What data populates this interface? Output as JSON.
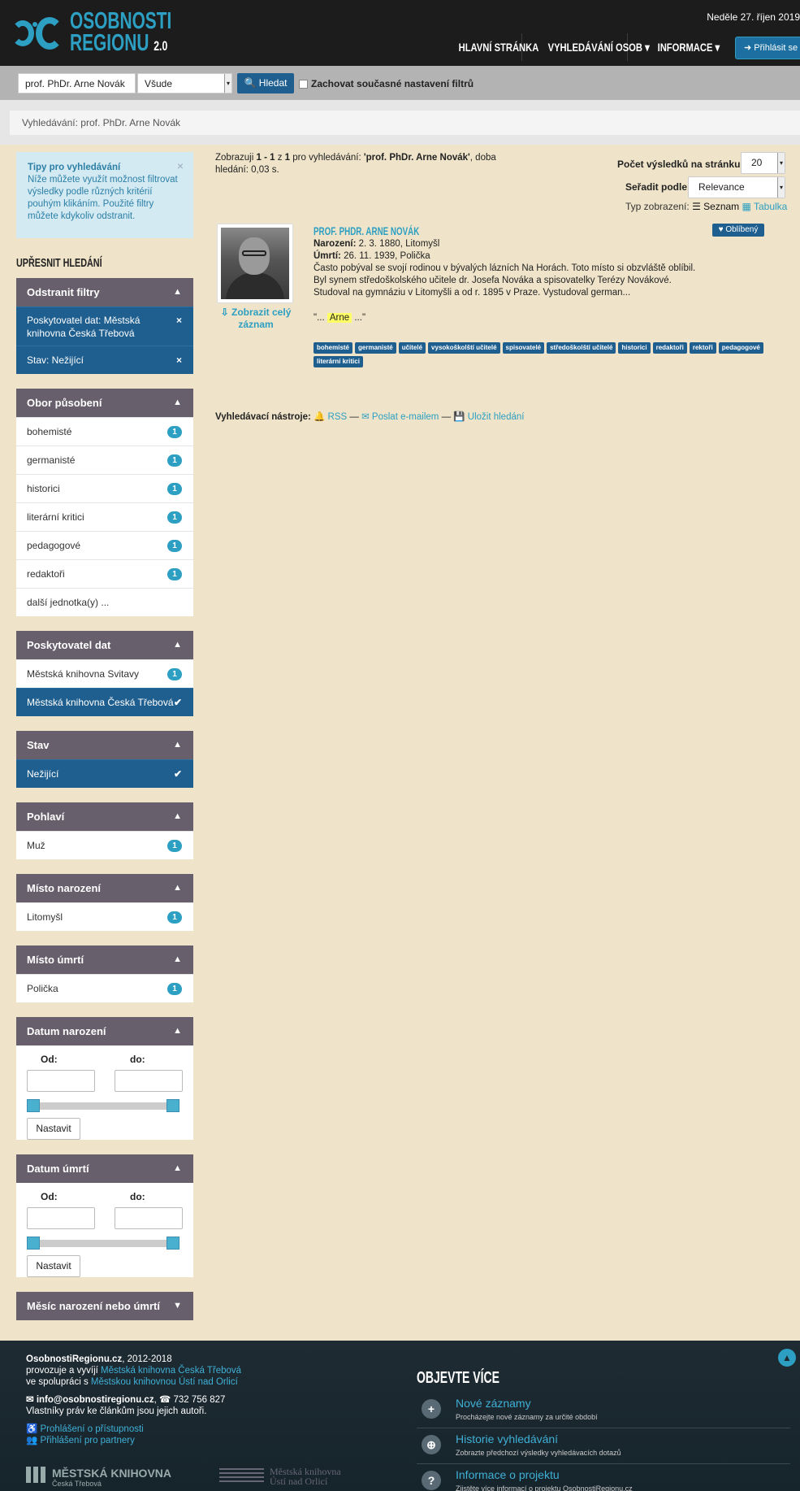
{
  "header": {
    "logo_line1": "OSOBNOSTI",
    "logo_line2": "REGIONU",
    "logo_version": "2.0",
    "date": "Neděle 27. říjen 2019",
    "nav": {
      "home": "HLAVNÍ STRÁNKA",
      "search": "VYHLEDÁVÁNÍ OSOB ▾",
      "info": "INFORMACE ▾"
    },
    "login": "➜ Přihlásit se"
  },
  "searchbar": {
    "query": "prof. PhDr. Arne Novák",
    "scope": "Všude",
    "search_button": "🔍 Hledat",
    "keep_filters": "Zachovat současné nastavení filtrů"
  },
  "breadcrumb": "Vyhledávání: prof. PhDr. Arne Novák",
  "sidebar": {
    "tips": {
      "title": "Tipy pro vyhledávání",
      "text": "Níže můžete využít možnost filtrovat výsledky podle různých kritérií pouhým klikáním. Použité filtry můžete kdykoliv odstranit.",
      "close": "×"
    },
    "refine_title": "UPŘESNIT HLEDÁNÍ",
    "remove_filters": {
      "title": "Odstranit filtry",
      "items": [
        {
          "label": "Poskytovatel dat: Městská knihovna Česká Třebová",
          "mark": "×"
        },
        {
          "label": "Stav: Nežijící",
          "mark": "×"
        }
      ]
    },
    "field": {
      "title": "Obor působení",
      "items": [
        {
          "label": "bohemisté",
          "count": "1"
        },
        {
          "label": "germanisté",
          "count": "1"
        },
        {
          "label": "historici",
          "count": "1"
        },
        {
          "label": "literární kritici",
          "count": "1"
        },
        {
          "label": "pedagogové",
          "count": "1"
        },
        {
          "label": "redaktoři",
          "count": "1"
        }
      ],
      "more": "další jednotka(y) ..."
    },
    "provider": {
      "title": "Poskytovatel dat",
      "items": [
        {
          "label": "Městská knihovna Svitavy",
          "count": "1"
        }
      ],
      "selected": "Městská knihovna Česká Třebová",
      "selected_mark": "✔"
    },
    "status": {
      "title": "Stav",
      "selected": "Nežijící",
      "selected_mark": "✔"
    },
    "gender": {
      "title": "Pohlaví",
      "items": [
        {
          "label": "Muž",
          "count": "1"
        }
      ]
    },
    "birthplace": {
      "title": "Místo narození",
      "items": [
        {
          "label": "Litomyšl",
          "count": "1"
        }
      ]
    },
    "deathplace": {
      "title": "Místo úmrtí",
      "items": [
        {
          "label": "Polička",
          "count": "1"
        }
      ]
    },
    "birthdate": {
      "title": "Datum narození",
      "from": "Od:",
      "to": "do:",
      "set": "Nastavit"
    },
    "deathdate": {
      "title": "Datum úmrtí",
      "from": "Od:",
      "to": "do:",
      "set": "Nastavit"
    },
    "month": {
      "title": "Měsíc narození nebo úmrtí"
    },
    "collapse_icon": "▲",
    "expand_icon": "▼"
  },
  "main": {
    "summary_prefix": "Zobrazuji ",
    "summary_range": "1 - 1",
    "summary_mid": " z ",
    "summary_total": "1",
    "summary_pre_query": " pro vyhledávání: ",
    "summary_query": "'prof. PhDr. Arne Novák'",
    "summary_time": ", doba hledání: 0,03 s.",
    "per_page_label": "Počet výsledků na stránku",
    "per_page_value": "20",
    "sort_label": "Seřadit podle",
    "sort_value": "Relevance",
    "view_label": "Typ zobrazení:",
    "view_list": "☰ Seznam",
    "view_table": "▦ Tabulka"
  },
  "result": {
    "title": "PROF. PHDR. ARNE NOVÁK",
    "fav": "♥ Oblíbený",
    "born_label": "Narození:",
    "born_value": " 2. 3. 1880, Litomyšl",
    "died_label": "Úmrtí:",
    "died_value": " 26. 11. 1939, Polička",
    "bio": "Často pobýval se svojí rodinou v bývalých lázních Na Horách. Toto místo si obzvláště oblíbil. Byl synem středoškolského učitele dr. Josefa Nováka a spisovatelky Terézy Novákové. Studoval na gymnáziu v Litomyšli a od r. 1895 v Praze. Vystudoval german...",
    "snippet_pre": "\"... ",
    "snippet_hl": "Arne",
    "snippet_post": " ...\"",
    "show_record": "⇩ Zobrazit celý záznam",
    "tags": [
      "bohemisté",
      "germanisté",
      "učitelé",
      "vysokoškolští učitelé",
      "spisovatelé",
      "středoškolští učitelé",
      "historici",
      "redaktoři",
      "rektoři",
      "pedagogové",
      "literární kritici"
    ]
  },
  "tools": {
    "label": "Vyhledávací nástroje:",
    "rss": "🔔 RSS",
    "sep1": " — ",
    "email": "✉ Poslat e-mailem",
    "sep2": " — ",
    "save": "💾 Uložit hledání"
  },
  "footer": {
    "site": "OsobnostiRegionu.cz",
    "years": ", 2012-2018",
    "run_by_pre": "provozuje a vyvíjí ",
    "run_by_lib": "Městská knihovna Česká Třebová",
    "coop_pre": "ve spolupráci s ",
    "coop_lib": "Městskou knihovnou Ústí nad Orlicí",
    "email": "✉ info@osobnostiregionu.cz",
    "phone": ", ☎ 732 756 827",
    "rights": "Vlastníky práv ke článkům jsou jejich autoři.",
    "accessibility": "♿ Prohlášení o přístupnosti",
    "partners": "👥 Přihlášení pro partnery",
    "lib1_name": "MĚSTSKÁ KNIHOVNA",
    "lib1_sub": "Česká Třebová",
    "lib2_line1": "Městská knihovna",
    "lib2_line2": "Ústí nad Orlicí",
    "discover_title": "OBJEVTE VÍCE",
    "discover": [
      {
        "icon": "+",
        "title": "Nové záznamy",
        "desc": "Procházejte nové záznamy za určité období"
      },
      {
        "icon": "⊕",
        "title": "Historie vyhledávání",
        "desc": "Zobrazte předchozí výsledky vyhledávacích dotazů"
      },
      {
        "icon": "?",
        "title": "Informace o projektu",
        "desc": "Zjistěte více informací o projektu OsobnostiRegionu.cz"
      }
    ],
    "to_top": "▲"
  }
}
